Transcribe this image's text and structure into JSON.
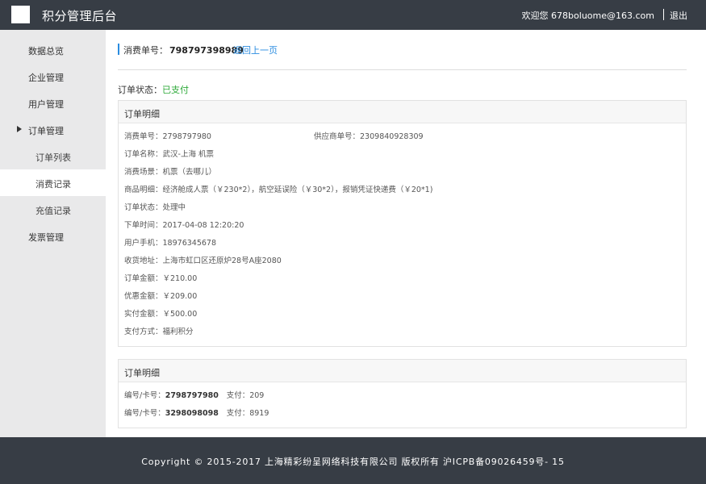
{
  "header": {
    "title": "积分管理后台",
    "welcome": "欢迎您 678boluome@163.com",
    "logout": "退出"
  },
  "sidebar": {
    "items": [
      {
        "label": "数据总览"
      },
      {
        "label": "企业管理"
      },
      {
        "label": "用户管理"
      },
      {
        "label": "订单管理"
      },
      {
        "label": "订单列表"
      },
      {
        "label": "消费记录"
      },
      {
        "label": "充值记录"
      },
      {
        "label": "发票管理"
      }
    ]
  },
  "page": {
    "order_no_label": "消费单号：",
    "order_no": "798797398989",
    "back_label": "返回上一页",
    "status_label": "订单状态：",
    "status_value": "已支付"
  },
  "detail": {
    "title": "订单明细",
    "rows": [
      {
        "label": "消费单号：",
        "value": "2798797980"
      },
      {
        "label": "订单名称：",
        "value": "武汉-上海  机票"
      },
      {
        "label": "消费场景：",
        "value": "机票（去哪儿）"
      },
      {
        "label": "商品明细：",
        "value": "经济舱成人票（￥230*2），航空延误险（￥30*2），报销凭证快递费（￥20*1)"
      },
      {
        "label": "订单状态：",
        "value": "处理中"
      },
      {
        "label": "下单时间：",
        "value": "2017-04-08  12:20:20"
      },
      {
        "label": "用户手机：",
        "value": "18976345678"
      },
      {
        "label": "收货地址：",
        "value": "上海市虹口区还原炉28号A座2080"
      },
      {
        "label": "订单金额：",
        "value": "￥210.00"
      },
      {
        "label": "优惠金额：",
        "value": "￥209.00"
      },
      {
        "label": "实付金额：",
        "value": "￥500.00"
      },
      {
        "label": "支付方式：",
        "value": "福利积分"
      }
    ],
    "supplier_label": "供应商单号：",
    "supplier_value": "2309840928309"
  },
  "payments": {
    "title": "订单明细",
    "rows": [
      {
        "label": "编号/卡号：",
        "card": "2798797980",
        "pay_label": "支付：",
        "pay": "209"
      },
      {
        "label": "编号/卡号：",
        "card": "3298098098",
        "pay_label": "支付：",
        "pay": "8919"
      }
    ]
  },
  "footer": {
    "text": "Copyright © 2015-2017 上海精彩纷呈网络科技有限公司 版权所有 沪ICPB备09026459号- 15"
  }
}
